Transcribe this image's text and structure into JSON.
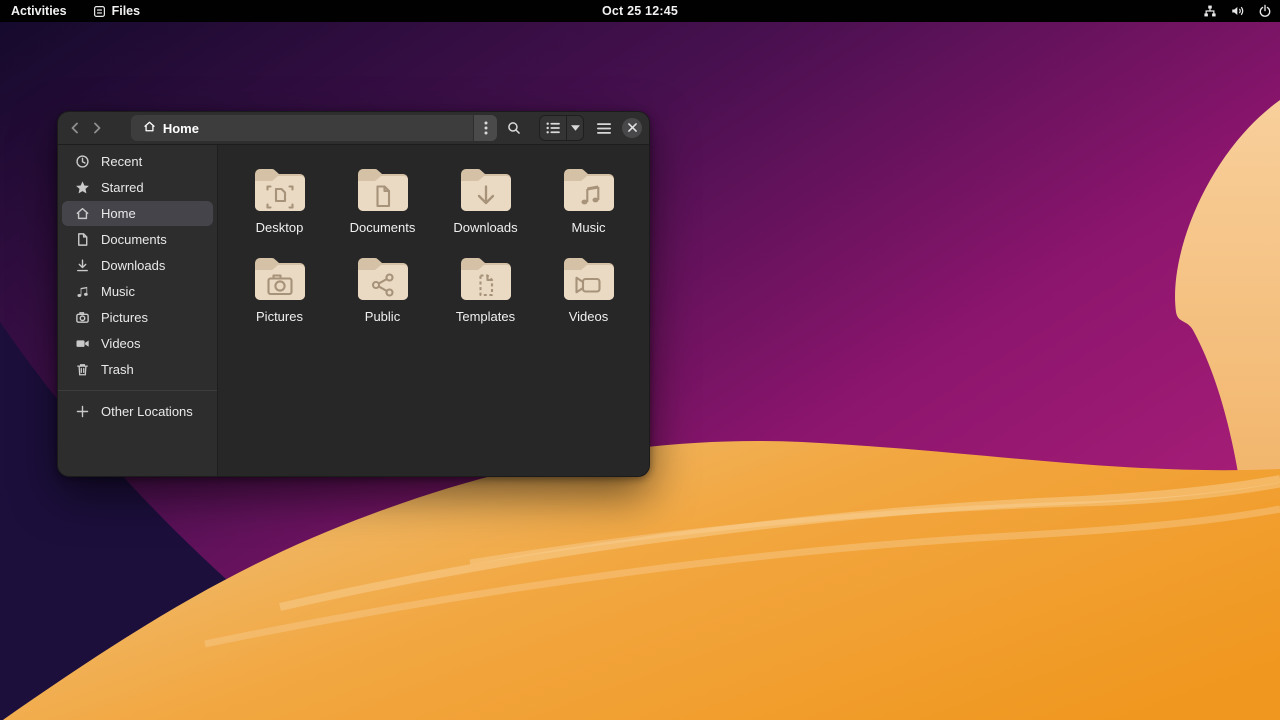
{
  "topbar": {
    "activities_label": "Activities",
    "app_name": "Files",
    "clock": "Oct 25 12:45",
    "status_icons": [
      "network-icon",
      "volume-icon",
      "power-icon"
    ]
  },
  "window": {
    "header": {
      "path_label": "Home",
      "controls": [
        "back",
        "forward",
        "kebab-menu",
        "search",
        "list-view",
        "view-options",
        "main-menu",
        "close"
      ]
    },
    "sidebar": {
      "items": [
        {
          "label": "Recent",
          "icon": "clock-icon"
        },
        {
          "label": "Starred",
          "icon": "star-icon"
        },
        {
          "label": "Home",
          "icon": "home-icon",
          "selected": true
        },
        {
          "label": "Documents",
          "icon": "document-icon"
        },
        {
          "label": "Downloads",
          "icon": "download-icon"
        },
        {
          "label": "Music",
          "icon": "music-note-icon"
        },
        {
          "label": "Pictures",
          "icon": "camera-icon"
        },
        {
          "label": "Videos",
          "icon": "video-camera-icon"
        },
        {
          "label": "Trash",
          "icon": "trash-icon"
        }
      ],
      "other_locations_label": "Other Locations"
    },
    "folders": [
      {
        "name": "Desktop",
        "emblem": "desktop-emblem"
      },
      {
        "name": "Documents",
        "emblem": "document-emblem"
      },
      {
        "name": "Downloads",
        "emblem": "download-arrow-emblem"
      },
      {
        "name": "Music",
        "emblem": "music-notes-emblem"
      },
      {
        "name": "Pictures",
        "emblem": "camera-emblem"
      },
      {
        "name": "Public",
        "emblem": "share-emblem"
      },
      {
        "name": "Templates",
        "emblem": "template-emblem"
      },
      {
        "name": "Videos",
        "emblem": "video-emblem"
      }
    ]
  },
  "colors": {
    "topbar_bg": "#010101",
    "window_bg": "#272727",
    "sidebar_bg": "#2d2d2d",
    "header_bg": "#2e2e2e",
    "pathbar_bg": "#3d3d3d",
    "selected_item_bg": "#45444b",
    "folder_body": "#ead9c3",
    "folder_tab": "#d4c1a6",
    "folder_emblem": "#a7927a",
    "sky_dark_navy": "#150a2d",
    "sky_purple": "#5d1162",
    "sky_magenta": "#a81e78",
    "dune_orange": "#f0981f",
    "dune_sand": "#eec27d",
    "dune_peach": "#f1ad56",
    "petal_light": "#f8cf9b"
  }
}
